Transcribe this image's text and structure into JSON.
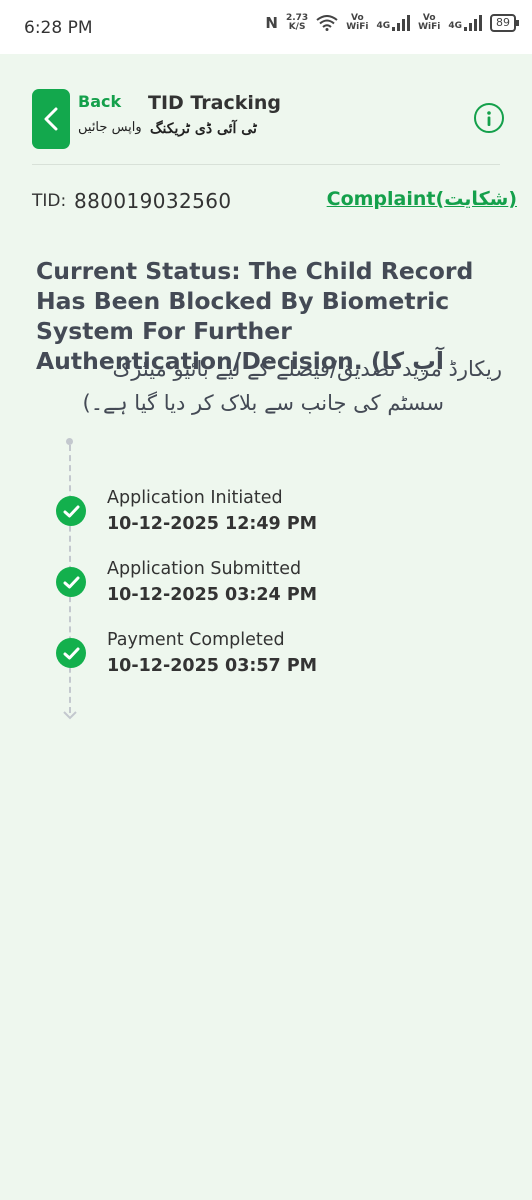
{
  "status_bar": {
    "time": "6:28 PM",
    "net_speed": "2.73",
    "net_unit": "K/S",
    "sim1_label_top": "Vo",
    "sim1_label_bottom": "WiFi",
    "sim1_net": "4G",
    "sim2_label_top": "Vo",
    "sim2_label_bottom": "WiFi",
    "sim2_net": "4G",
    "battery": "89"
  },
  "header": {
    "back_label": "Back",
    "back_urdu": "واپس جائیں",
    "title": "TID Tracking",
    "title_urdu": "ٹی آئی ڈی ٹریکنگ",
    "back_icon": "chevron-left-icon",
    "info_icon": "info-icon",
    "accent_color": "#14a04b"
  },
  "tid": {
    "label": "TID:",
    "value": "880019032560",
    "complaint_link": "Complaint(شکایت)"
  },
  "status": {
    "english": "Current Status: The Child Record Has Been Blocked By Biometric System For Further Authentication/Decision. (آپ کا",
    "urdu_line_2": "ریکارڈ مزید تصدیق/فیصلے کے لیے بائیو میٹرک",
    "urdu_line_3": "سسٹم کی جانب سے بلاک کر دیا گیا ہے۔)"
  },
  "timeline": [
    {
      "title": "Application Initiated",
      "date": "10-12-2025 12:49 PM",
      "icon": "check-circle-icon"
    },
    {
      "title": "Application Submitted",
      "date": "10-12-2025 03:24 PM",
      "icon": "check-circle-icon"
    },
    {
      "title": "Payment Completed",
      "date": "10-12-2025 03:57 PM",
      "icon": "check-circle-icon"
    }
  ]
}
